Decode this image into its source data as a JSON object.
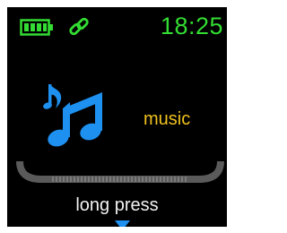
{
  "status_bar": {
    "time": "18:25",
    "battery_icon": "battery-full-icon",
    "link_icon": "link-icon"
  },
  "app": {
    "icon": "music-note-icon",
    "label": "music"
  },
  "progress": {
    "filled": 0
  },
  "hint": {
    "label": "long press",
    "arrow_icon": "triangle-down-icon"
  },
  "colors": {
    "background": "#000000",
    "status_green": "#33dd33",
    "icon_blue": "#1e90f0",
    "label_yellow": "#f0c21e",
    "text_white": "#f2f2f2",
    "track_gray": "#5a5a5a"
  }
}
